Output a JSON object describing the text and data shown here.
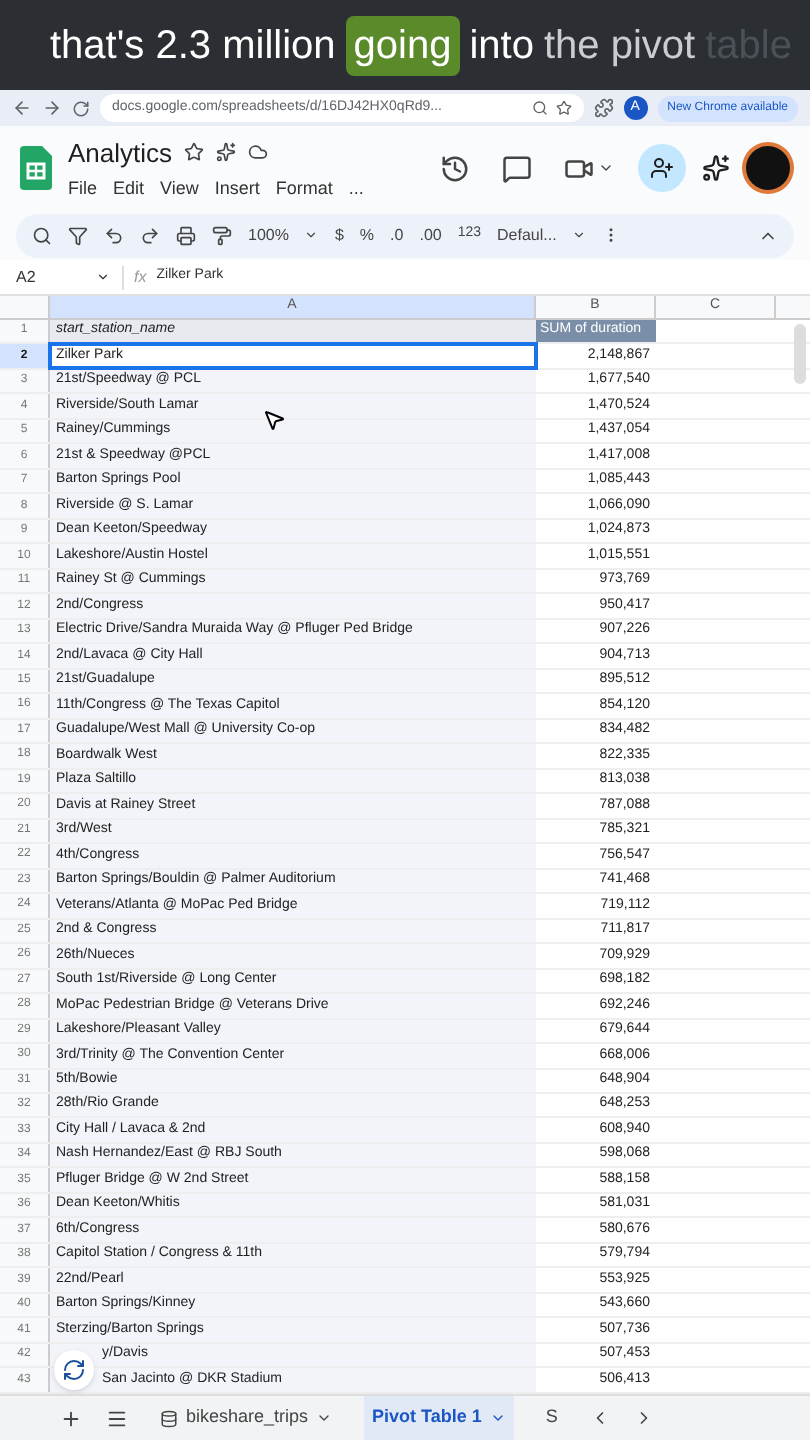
{
  "caption": [
    {
      "text": "that's 2.3 million",
      "kind": "normal"
    },
    {
      "text": "going",
      "kind": "highlight"
    },
    {
      "text": "into",
      "kind": "normal"
    },
    {
      "text": "the pivot",
      "kind": "dim"
    },
    {
      "text": "table",
      "kind": "faint"
    }
  ],
  "browser": {
    "url": "docs.google.com/spreadsheets/d/16DJ42HX0qRd9...",
    "profile": "A",
    "update": "New Chrome available"
  },
  "doc": {
    "title": "Analytics",
    "menu": [
      "File",
      "Edit",
      "View",
      "Insert",
      "Format",
      "..."
    ]
  },
  "toolbar": {
    "zoom": "100%",
    "currency": "$",
    "percent": "%",
    "dec_less": ".0",
    "dec_more": ".00",
    "number_format": "123",
    "font": "Defaul..."
  },
  "formula_bar": {
    "cell": "A2",
    "fx": "fx",
    "value": "Zilker Park"
  },
  "columns": [
    "A",
    "B",
    "C"
  ],
  "rows": [
    {
      "n": "1",
      "a": "start_station_name",
      "b": "SUM of duration",
      "kind": "header",
      "selected": false
    },
    {
      "n": "2",
      "a": "Zilker Park",
      "b": "2,148,867",
      "kind": "data",
      "selected": true
    },
    {
      "n": "3",
      "a": "21st/Speedway @ PCL",
      "b": "1,677,540",
      "kind": "data",
      "selected": false
    },
    {
      "n": "4",
      "a": "Riverside/South Lamar",
      "b": "1,470,524",
      "kind": "data",
      "selected": false
    },
    {
      "n": "5",
      "a": "Rainey/Cummings",
      "b": "1,437,054",
      "kind": "data",
      "selected": false
    },
    {
      "n": "6",
      "a": "21st & Speedway @PCL",
      "b": "1,417,008",
      "kind": "data",
      "selected": false
    },
    {
      "n": "7",
      "a": "Barton Springs Pool",
      "b": "1,085,443",
      "kind": "data",
      "selected": false
    },
    {
      "n": "8",
      "a": "Riverside @ S. Lamar",
      "b": "1,066,090",
      "kind": "data",
      "selected": false
    },
    {
      "n": "9",
      "a": "Dean Keeton/Speedway",
      "b": "1,024,873",
      "kind": "data",
      "selected": false
    },
    {
      "n": "10",
      "a": "Lakeshore/Austin Hostel",
      "b": "1,015,551",
      "kind": "data",
      "selected": false
    },
    {
      "n": "11",
      "a": "Rainey St @ Cummings",
      "b": "973,769",
      "kind": "data",
      "selected": false
    },
    {
      "n": "12",
      "a": "2nd/Congress",
      "b": "950,417",
      "kind": "data",
      "selected": false
    },
    {
      "n": "13",
      "a": "Electric Drive/Sandra Muraida Way @ Pfluger Ped Bridge",
      "b": "907,226",
      "kind": "data",
      "selected": false
    },
    {
      "n": "14",
      "a": "2nd/Lavaca @ City Hall",
      "b": "904,713",
      "kind": "data",
      "selected": false
    },
    {
      "n": "15",
      "a": "21st/Guadalupe",
      "b": "895,512",
      "kind": "data",
      "selected": false
    },
    {
      "n": "16",
      "a": "11th/Congress @ The Texas Capitol",
      "b": "854,120",
      "kind": "data",
      "selected": false
    },
    {
      "n": "17",
      "a": "Guadalupe/West Mall @ University Co-op",
      "b": "834,482",
      "kind": "data",
      "selected": false
    },
    {
      "n": "18",
      "a": "Boardwalk West",
      "b": "822,335",
      "kind": "data",
      "selected": false
    },
    {
      "n": "19",
      "a": "Plaza Saltillo",
      "b": "813,038",
      "kind": "data",
      "selected": false
    },
    {
      "n": "20",
      "a": "Davis at Rainey Street",
      "b": "787,088",
      "kind": "data",
      "selected": false
    },
    {
      "n": "21",
      "a": "3rd/West",
      "b": "785,321",
      "kind": "data",
      "selected": false
    },
    {
      "n": "22",
      "a": "4th/Congress",
      "b": "756,547",
      "kind": "data",
      "selected": false
    },
    {
      "n": "23",
      "a": "Barton Springs/Bouldin @ Palmer Auditorium",
      "b": "741,468",
      "kind": "data",
      "selected": false
    },
    {
      "n": "24",
      "a": "Veterans/Atlanta @ MoPac Ped Bridge",
      "b": "719,112",
      "kind": "data",
      "selected": false
    },
    {
      "n": "25",
      "a": "2nd & Congress",
      "b": "711,817",
      "kind": "data",
      "selected": false
    },
    {
      "n": "26",
      "a": "26th/Nueces",
      "b": "709,929",
      "kind": "data",
      "selected": false
    },
    {
      "n": "27",
      "a": "South 1st/Riverside @ Long Center",
      "b": "698,182",
      "kind": "data",
      "selected": false
    },
    {
      "n": "28",
      "a": "MoPac Pedestrian Bridge @ Veterans Drive",
      "b": "692,246",
      "kind": "data",
      "selected": false
    },
    {
      "n": "29",
      "a": "Lakeshore/Pleasant Valley",
      "b": "679,644",
      "kind": "data",
      "selected": false
    },
    {
      "n": "30",
      "a": "3rd/Trinity @ The Convention Center",
      "b": "668,006",
      "kind": "data",
      "selected": false
    },
    {
      "n": "31",
      "a": "5th/Bowie",
      "b": "648,904",
      "kind": "data",
      "selected": false
    },
    {
      "n": "32",
      "a": "28th/Rio Grande",
      "b": "648,253",
      "kind": "data",
      "selected": false
    },
    {
      "n": "33",
      "a": "City Hall / Lavaca & 2nd",
      "b": "608,940",
      "kind": "data",
      "selected": false
    },
    {
      "n": "34",
      "a": "Nash Hernandez/East @ RBJ South",
      "b": "598,068",
      "kind": "data",
      "selected": false
    },
    {
      "n": "35",
      "a": "Pfluger Bridge @ W 2nd Street",
      "b": "588,158",
      "kind": "data",
      "selected": false
    },
    {
      "n": "36",
      "a": "Dean Keeton/Whitis",
      "b": "581,031",
      "kind": "data",
      "selected": false
    },
    {
      "n": "37",
      "a": "6th/Congress",
      "b": "580,676",
      "kind": "data",
      "selected": false
    },
    {
      "n": "38",
      "a": "Capitol Station / Congress & 11th",
      "b": "579,794",
      "kind": "data",
      "selected": false
    },
    {
      "n": "39",
      "a": "22nd/Pearl",
      "b": "553,925",
      "kind": "data",
      "selected": false
    },
    {
      "n": "40",
      "a": "Barton Springs/Kinney",
      "b": "543,660",
      "kind": "data",
      "selected": false
    },
    {
      "n": "41",
      "a": "Sterzing/Barton Springs",
      "b": "507,736",
      "kind": "data",
      "selected": false
    },
    {
      "n": "42",
      "a": "y/Davis",
      "b": "507,453",
      "kind": "covered",
      "selected": false
    },
    {
      "n": "43",
      "a": "San Jacinto @ DKR Stadium",
      "b": "506,413",
      "kind": "covered",
      "selected": false
    }
  ],
  "sheet_tabs": [
    {
      "label": "bikeshare_trips",
      "selected": false
    },
    {
      "label": "Pivot Table 1",
      "selected": true
    },
    {
      "label": "S",
      "selected": false
    }
  ]
}
